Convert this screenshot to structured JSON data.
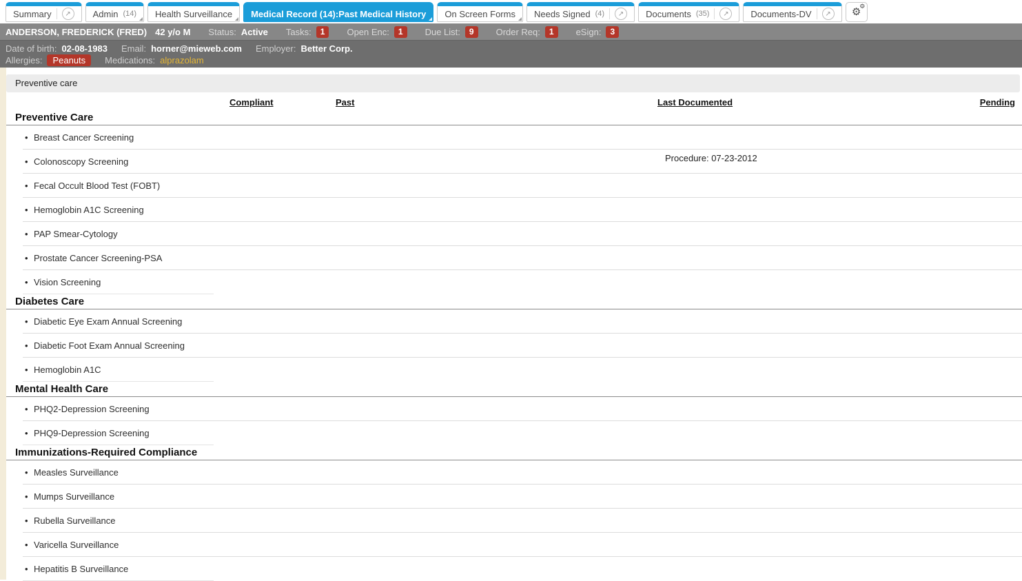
{
  "icons": {
    "external_link": "circle-arrow-icon",
    "external_glyph": "↗",
    "settings": "gears-icon",
    "gear_glyph": "⚙",
    "bullet_glyph": "•",
    "dropdown": "corner-triangle-icon"
  },
  "colors": {
    "tab_blue": "#1b9dd9",
    "patient_bar_gray": "#878787",
    "info_bar_gray": "#6e6e6e",
    "badge_red": "#b43629",
    "medication_yellow": "#e6b735",
    "page_edge_beige": "#f3ecd9",
    "band_gray": "#ececec"
  },
  "tabs": [
    {
      "label": "Summary",
      "count": "",
      "link_icon": true,
      "dropdown": false,
      "active": false
    },
    {
      "label": "Admin",
      "count": "(14)",
      "link_icon": false,
      "dropdown": true,
      "active": false
    },
    {
      "label": "Health Surveillance",
      "count": "",
      "link_icon": false,
      "dropdown": true,
      "active": false
    },
    {
      "label": "Medical Record (14):Past Medical History",
      "count": "",
      "link_icon": false,
      "dropdown": true,
      "active": true
    },
    {
      "label": "On Screen Forms",
      "count": "",
      "link_icon": false,
      "dropdown": true,
      "active": false
    },
    {
      "label": "Needs Signed",
      "count": "(4)",
      "link_icon": true,
      "dropdown": false,
      "active": false
    },
    {
      "label": "Documents",
      "count": "(35)",
      "link_icon": true,
      "dropdown": false,
      "active": false
    },
    {
      "label": "Documents-DV",
      "count": "",
      "link_icon": true,
      "dropdown": false,
      "active": false
    }
  ],
  "patient_bar": {
    "name": "ANDERSON, FREDERICK (FRED)",
    "age_sex": "42 y/o M",
    "status_label": "Status:",
    "status_value": "Active",
    "counters": [
      {
        "label": "Tasks:",
        "value": "1"
      },
      {
        "label": "Open Enc:",
        "value": "1"
      },
      {
        "label": "Due List:",
        "value": "9"
      },
      {
        "label": "Order Req:",
        "value": "1"
      },
      {
        "label": "eSign:",
        "value": "3"
      }
    ]
  },
  "info_bar": {
    "dob_label": "Date of birth:",
    "dob_value": "02-08-1983",
    "email_label": "Email:",
    "email_value": "horner@mieweb.com",
    "employer_label": "Employer:",
    "employer_value": "Better Corp.",
    "allergies_label": "Allergies:",
    "allergies": [
      "Peanuts"
    ],
    "medications_label": "Medications:",
    "medications_value": "alprazolam"
  },
  "panel": {
    "title": "Preventive care",
    "columns": [
      "Compliant",
      "Past",
      "Last Documented",
      "Pending"
    ],
    "sections": [
      {
        "name": "Preventive Care",
        "items": [
          {
            "name": "Breast Cancer Screening",
            "compliant": "",
            "past": "",
            "last_documented": "",
            "pending": ""
          },
          {
            "name": "Colonoscopy Screening",
            "compliant": "",
            "past": "",
            "last_documented": "Procedure: 07-23-2012",
            "pending": ""
          },
          {
            "name": "Fecal Occult Blood Test (FOBT)",
            "compliant": "",
            "past": "",
            "last_documented": "",
            "pending": ""
          },
          {
            "name": "Hemoglobin A1C Screening",
            "compliant": "",
            "past": "",
            "last_documented": "",
            "pending": ""
          },
          {
            "name": "PAP Smear-Cytology",
            "compliant": "",
            "past": "",
            "last_documented": "",
            "pending": ""
          },
          {
            "name": "Prostate Cancer Screening-PSA",
            "compliant": "",
            "past": "",
            "last_documented": "",
            "pending": ""
          },
          {
            "name": "Vision Screening",
            "compliant": "",
            "past": "",
            "last_documented": "",
            "pending": ""
          }
        ]
      },
      {
        "name": "Diabetes Care",
        "items": [
          {
            "name": "Diabetic Eye Exam Annual Screening",
            "compliant": "",
            "past": "",
            "last_documented": "",
            "pending": ""
          },
          {
            "name": "Diabetic Foot Exam Annual Screening",
            "compliant": "",
            "past": "",
            "last_documented": "",
            "pending": ""
          },
          {
            "name": "Hemoglobin A1C",
            "compliant": "",
            "past": "",
            "last_documented": "",
            "pending": ""
          }
        ]
      },
      {
        "name": "Mental Health Care",
        "items": [
          {
            "name": "PHQ2-Depression Screening",
            "compliant": "",
            "past": "",
            "last_documented": "",
            "pending": ""
          },
          {
            "name": "PHQ9-Depression Screening",
            "compliant": "",
            "past": "",
            "last_documented": "",
            "pending": ""
          }
        ]
      },
      {
        "name": "Immunizations-Required Compliance",
        "items": [
          {
            "name": "Measles Surveillance",
            "compliant": "",
            "past": "",
            "last_documented": "",
            "pending": ""
          },
          {
            "name": "Mumps Surveillance",
            "compliant": "",
            "past": "",
            "last_documented": "",
            "pending": ""
          },
          {
            "name": "Rubella Surveillance",
            "compliant": "",
            "past": "",
            "last_documented": "",
            "pending": ""
          },
          {
            "name": "Varicella Surveillance",
            "compliant": "",
            "past": "",
            "last_documented": "",
            "pending": ""
          },
          {
            "name": "Hepatitis B Surveillance",
            "compliant": "",
            "past": "",
            "last_documented": "",
            "pending": ""
          }
        ]
      }
    ]
  }
}
